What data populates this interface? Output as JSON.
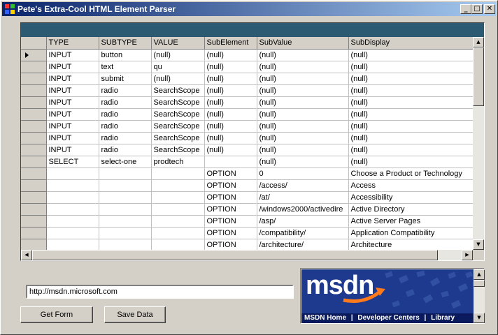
{
  "window": {
    "title": "Pete's Extra-Cool HTML Element Parser",
    "controls": {
      "minimize": "_",
      "maximize": "□",
      "close": "✕"
    }
  },
  "grid": {
    "columns": [
      "TYPE",
      "SUBTYPE",
      "VALUE",
      "SubElement",
      "SubValue",
      "SubDisplay"
    ],
    "rows": [
      [
        "INPUT",
        "button",
        "(null)",
        "(null)",
        "(null)",
        "(null)"
      ],
      [
        "INPUT",
        "text",
        "qu",
        "(null)",
        "(null)",
        "(null)"
      ],
      [
        "INPUT",
        "submit",
        "(null)",
        "(null)",
        "(null)",
        "(null)"
      ],
      [
        "INPUT",
        "radio",
        "SearchScope",
        "(null)",
        "(null)",
        "(null)"
      ],
      [
        "INPUT",
        "radio",
        "SearchScope",
        "(null)",
        "(null)",
        "(null)"
      ],
      [
        "INPUT",
        "radio",
        "SearchScope",
        "(null)",
        "(null)",
        "(null)"
      ],
      [
        "INPUT",
        "radio",
        "SearchScope",
        "(null)",
        "(null)",
        "(null)"
      ],
      [
        "INPUT",
        "radio",
        "SearchScope",
        "(null)",
        "(null)",
        "(null)"
      ],
      [
        "INPUT",
        "radio",
        "SearchScope",
        "(null)",
        "(null)",
        "(null)"
      ],
      [
        "SELECT",
        "select-one",
        "prodtech",
        "",
        "(null)",
        "(null)"
      ],
      [
        "",
        "",
        "",
        "OPTION",
        "0",
        "Choose a Product or Technology"
      ],
      [
        "",
        "",
        "",
        "OPTION",
        "/access/",
        "Access"
      ],
      [
        "",
        "",
        "",
        "OPTION",
        "/at/",
        "Accessibility"
      ],
      [
        "",
        "",
        "",
        "OPTION",
        "/windows2000/activedire",
        "Active Directory"
      ],
      [
        "",
        "",
        "",
        "OPTION",
        "/asp/",
        "Active Server Pages"
      ],
      [
        "",
        "",
        "",
        "OPTION",
        "/compatibility/",
        "Application Compatibility"
      ],
      [
        "",
        "",
        "",
        "OPTION",
        "/architecture/",
        "Architecture"
      ]
    ],
    "current_row_index": 0
  },
  "url_field": {
    "value": "http://msdn.microsoft.com"
  },
  "buttons": {
    "get_form": "Get Form",
    "save_data": "Save Data"
  },
  "banner": {
    "logo_text": "msdn",
    "nav_items": [
      "MSDN Home",
      "Developer Centers",
      "Library"
    ],
    "separator": "|"
  },
  "colors": {
    "title_start": "#0a246a",
    "title_end": "#a6caf0",
    "grid_caption": "#2c5a73",
    "banner_bg": "#1e3a8e"
  }
}
